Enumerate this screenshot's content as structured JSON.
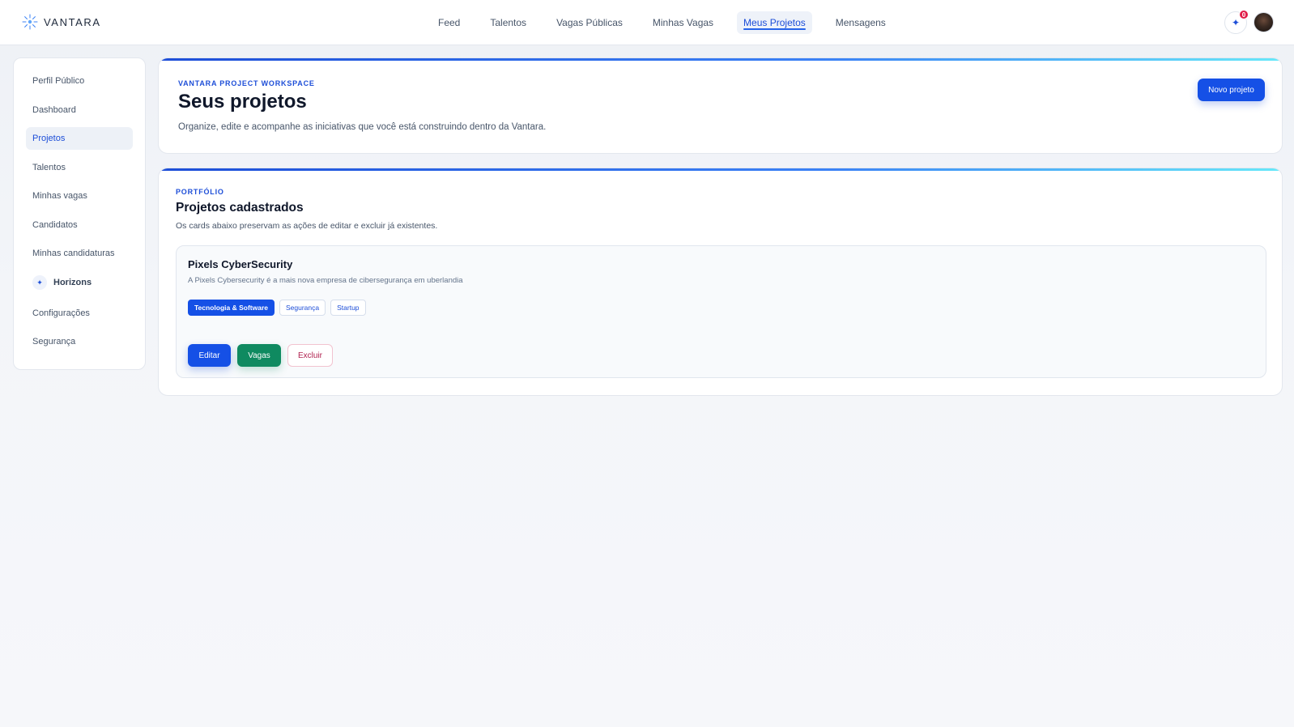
{
  "brand": {
    "name": "VANTARA"
  },
  "nav": {
    "items": [
      {
        "label": "Feed",
        "active": false
      },
      {
        "label": "Talentos",
        "active": false
      },
      {
        "label": "Vagas Públicas",
        "active": false
      },
      {
        "label": "Minhas Vagas",
        "active": false
      },
      {
        "label": "Meus Projetos",
        "active": true
      },
      {
        "label": "Mensagens",
        "active": false
      }
    ],
    "notification_count": "0"
  },
  "sidebar": {
    "items": [
      {
        "label": "Perfil Público"
      },
      {
        "label": "Dashboard"
      },
      {
        "label": "Projetos",
        "active": true
      },
      {
        "label": "Talentos"
      },
      {
        "label": "Minhas vagas"
      },
      {
        "label": "Candidatos"
      },
      {
        "label": "Minhas candidaturas"
      },
      {
        "label": "Horizons"
      },
      {
        "label": "Configurações"
      },
      {
        "label": "Segurança"
      }
    ]
  },
  "hero": {
    "eyebrow": "VANTARA PROJECT WORKSPACE",
    "title": "Seus projetos",
    "description": "Organize, edite e acompanhe as iniciativas que você está construindo dentro da Vantara.",
    "new_button": "Novo projeto"
  },
  "portfolio": {
    "eyebrow": "PORTFÓLIO",
    "title": "Projetos cadastrados",
    "description": "Os cards abaixo preservam as ações de editar e excluir já existentes.",
    "projects": [
      {
        "name": "Pixels CyberSecurity",
        "description": "A Pixels Cybersecurity é a mais nova empresa de cibersegurança em uberlandia",
        "tags": [
          "Tecnologia & Software",
          "Segurança",
          "Startup"
        ],
        "actions": {
          "edit": "Editar",
          "jobs": "Vagas",
          "delete": "Excluir"
        }
      }
    ]
  },
  "colors": {
    "accent": "#1550e6",
    "success": "#0f8a60",
    "danger": "#b0214f",
    "badge": "#e11d48"
  }
}
